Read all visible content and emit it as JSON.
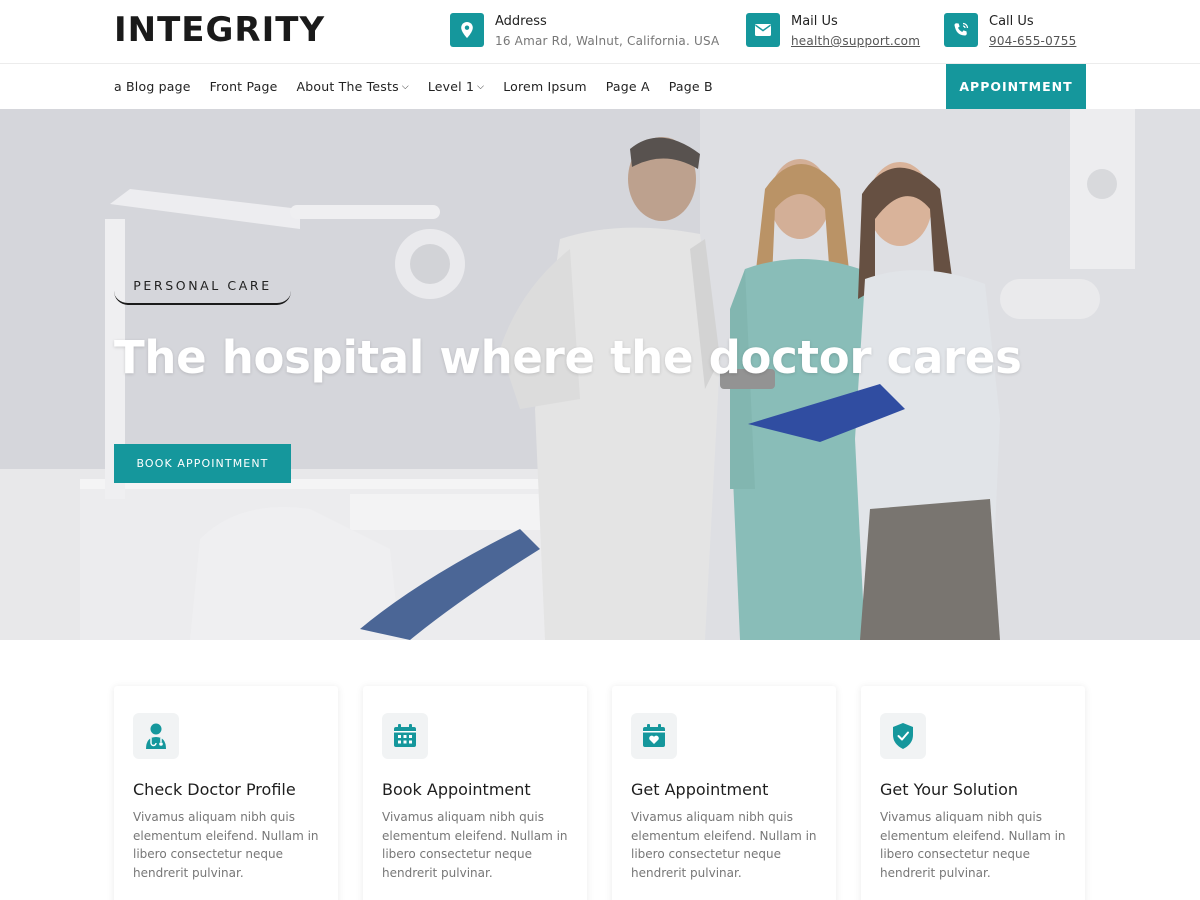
{
  "brand": {
    "logo": "INTEGRITY",
    "accent": "#15979c"
  },
  "header": {
    "contacts": [
      {
        "icon": "location-pin-icon",
        "title": "Address",
        "value": "16 Amar Rd, Walnut, California. USA"
      },
      {
        "icon": "mail-icon",
        "title": "Mail Us",
        "value": "health@support.com"
      },
      {
        "icon": "phone-icon",
        "title": "Call Us",
        "value": "904-655-0755"
      }
    ]
  },
  "nav": {
    "items": [
      {
        "label": "a Blog page"
      },
      {
        "label": "Front Page"
      },
      {
        "label": "About The Tests",
        "dropdown": true
      },
      {
        "label": "Level 1",
        "dropdown": true
      },
      {
        "label": "Lorem Ipsum"
      },
      {
        "label": "Page A"
      },
      {
        "label": "Page B"
      }
    ],
    "cta": "APPOINTMENT"
  },
  "hero": {
    "tag": "PERSONAL CARE",
    "headline": "The hospital where the doctor cares",
    "button": "BOOK APPOINTMENT"
  },
  "features": [
    {
      "icon": "doctor-icon",
      "title": "Check Doctor Profile",
      "text": "Vivamus aliquam nibh quis elementum eleifend. Nullam in libero consectetur neque hendrerit pulvinar."
    },
    {
      "icon": "calendar-icon",
      "title": "Book Appointment",
      "text": "Vivamus aliquam nibh quis elementum eleifend. Nullam in libero consectetur neque hendrerit pulvinar."
    },
    {
      "icon": "calendar-heart-icon",
      "title": "Get Appointment",
      "text": "Vivamus aliquam nibh quis elementum eleifend. Nullam in libero consectetur neque hendrerit pulvinar."
    },
    {
      "icon": "shield-check-icon",
      "title": "Get Your Solution",
      "text": "Vivamus aliquam nibh quis elementum eleifend. Nullam in libero consectetur neque hendrerit pulvinar."
    }
  ]
}
